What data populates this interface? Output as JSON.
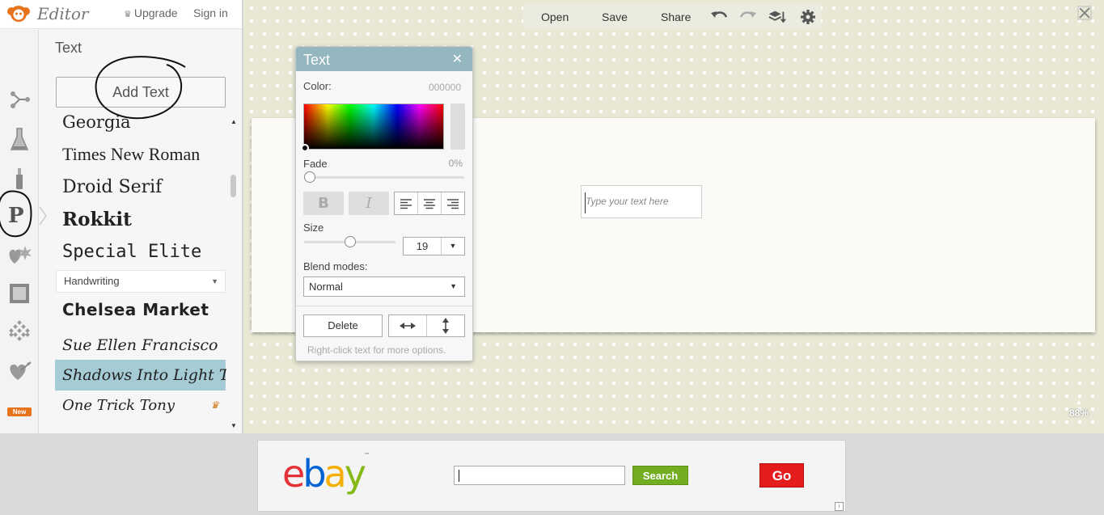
{
  "app": {
    "brand": "Editor",
    "upgrade_label": "Upgrade",
    "signin_label": "Sign in"
  },
  "sidebar": {
    "rail_icons": [
      "effects-icon",
      "filters-icon",
      "touch-up-icon",
      "text-icon",
      "overlays-icon",
      "frames-icon",
      "textures-icon",
      "seasonal-icon"
    ],
    "new_badge": "New",
    "panel_title": "Text",
    "add_text_label": "Add Text",
    "fonts_top": [
      "Georgia",
      "Times New Roman",
      "Droid Serif",
      "Rokkit",
      "Special Elite"
    ],
    "category": "Handwriting",
    "fonts_handwriting": [
      "Chelsea Market",
      "Sue Ellen Francisco",
      "Shadows Into Light Two",
      "One Trick Tony"
    ],
    "selected_font": "Shadows Into Light Two",
    "premium_font": "One Trick Tony"
  },
  "toolbar": {
    "open_label": "Open",
    "save_label": "Save",
    "share_label": "Share",
    "icons": [
      "undo-icon",
      "redo-icon",
      "layers-icon",
      "settings-icon"
    ]
  },
  "canvas": {
    "text_placeholder": "Type your text here",
    "zoom_level": "88%"
  },
  "text_dialog": {
    "title": "Text",
    "color_label": "Color:",
    "color_hex": "000000",
    "fade_label": "Fade",
    "fade_value": "0%",
    "bold_label": "B",
    "italic_label": "I",
    "size_label": "Size",
    "size_value": "19",
    "blend_label": "Blend modes:",
    "blend_value": "Normal",
    "delete_label": "Delete",
    "hint": "Right-click text for more options."
  },
  "ad": {
    "logo_letters": [
      "e",
      "b",
      "a",
      "y"
    ],
    "logo_colors": [
      "#e53238",
      "#0064d2",
      "#f5af02",
      "#86b817"
    ],
    "tm": "™",
    "search_label": "Search",
    "go_label": "Go"
  },
  "colors": {
    "dialog_header": "#94b6bf",
    "selected_font_bg": "#a5cbd4",
    "workspace_bg": "#e8e8d5",
    "search_button": "#73ad21",
    "go_button": "#e51c1c"
  }
}
